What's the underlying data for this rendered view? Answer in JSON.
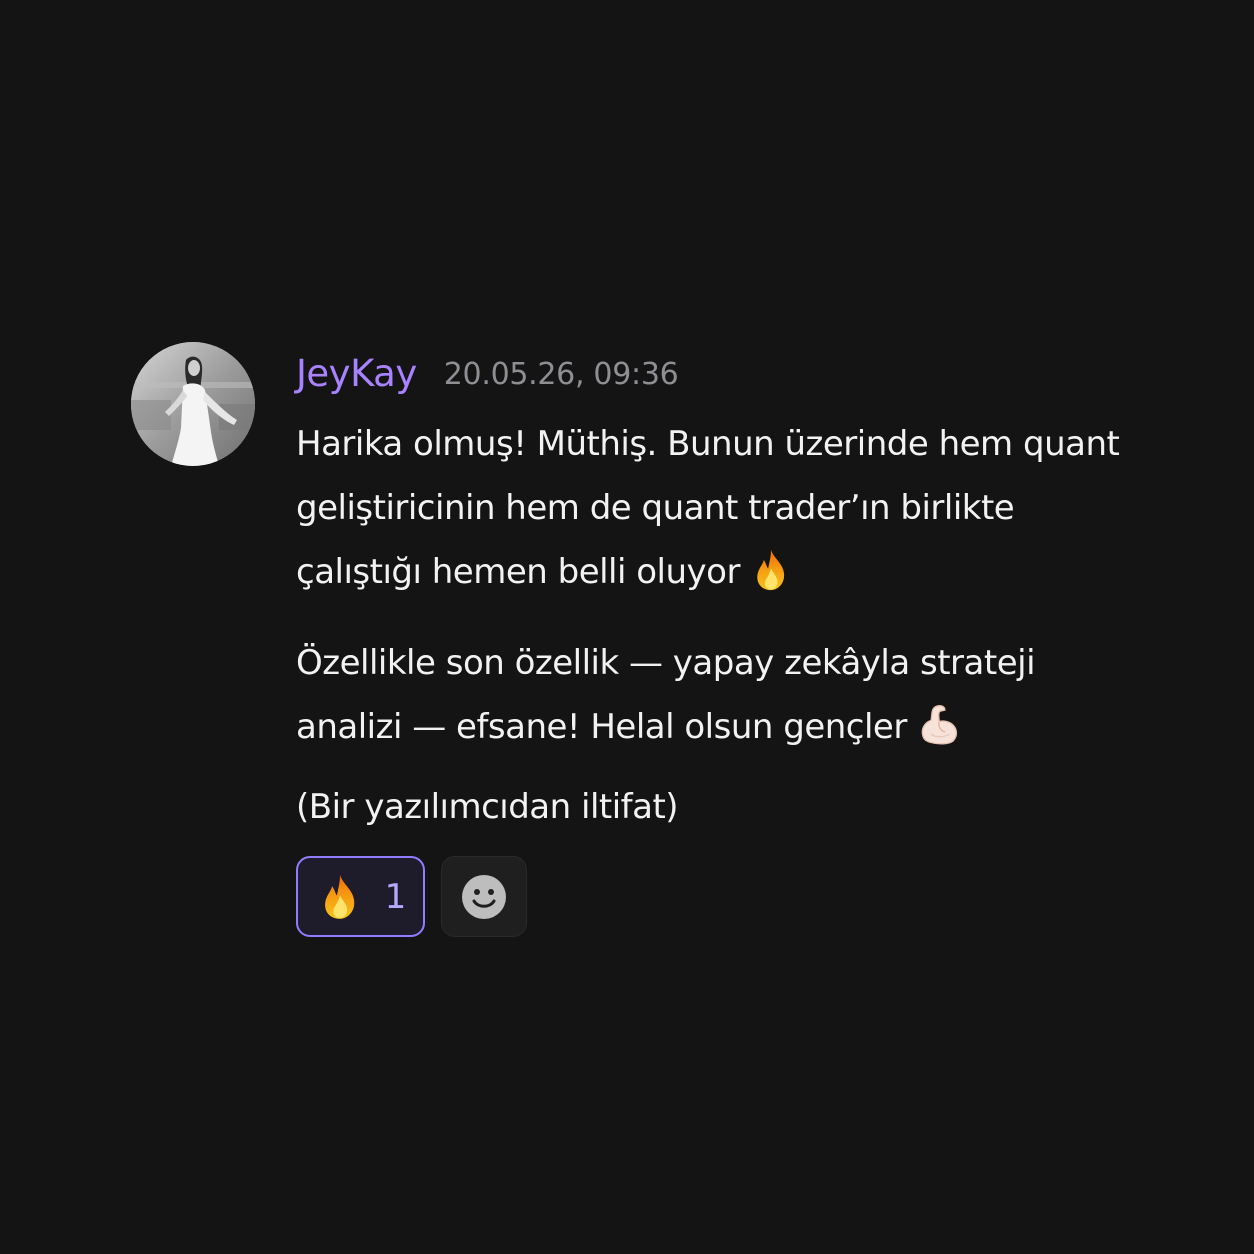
{
  "message": {
    "author": "JeyKay",
    "timestamp": "20.05.26, 09:36",
    "paragraphs": [
      "Harika olmuş! Müthiş. Bunun üzerinde hem quant\ngeliştiricinin hem de quant trader’ın birlikte\nçalıştığı hemen belli oluyor",
      "Özellikle son özellik — yapay zekâyla strateji\nanalizi — efsane! Helal olsun gençler",
      "(Bir yazılımcıdan iltifat)"
    ],
    "paragraph_emojis": [
      "fire-icon",
      "flexed-biceps-icon"
    ]
  },
  "reactions": [
    {
      "emoji": "fire-icon",
      "count": "1",
      "selected": true
    }
  ],
  "add_reaction_icon": "smiley-icon",
  "colors": {
    "background": "#141414",
    "username": "#a882ff",
    "timestamp": "#8e8e93",
    "text": "#f2f2f2",
    "reaction_border": "#8f7cff"
  }
}
